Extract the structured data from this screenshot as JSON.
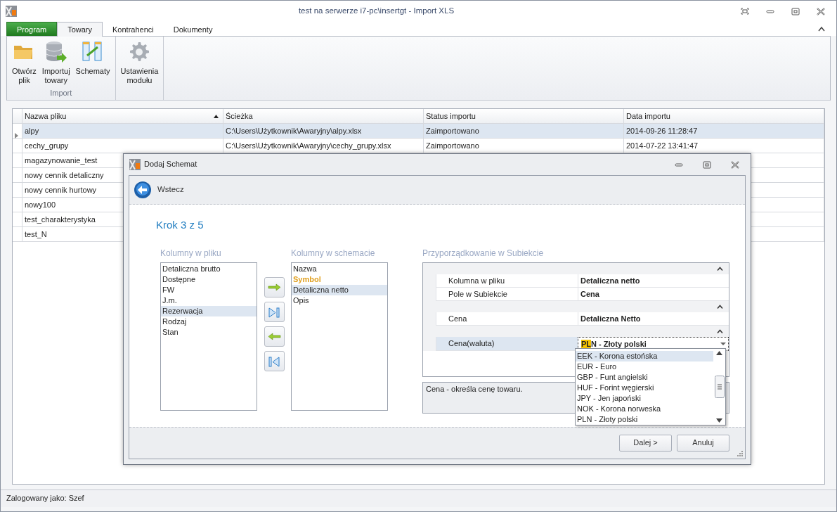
{
  "window": {
    "title": "test na serwerze i7-pc\\insertgt - Import XLS"
  },
  "ribbon_tabs": [
    {
      "label": "Program",
      "kind": "app",
      "selected": false
    },
    {
      "label": "Towary",
      "kind": "tab",
      "selected": true
    },
    {
      "label": "Kontrahenci",
      "kind": "tab",
      "selected": false
    },
    {
      "label": "Dokumenty",
      "kind": "tab",
      "selected": false
    }
  ],
  "ribbon_groups": [
    {
      "label": "Import",
      "buttons": [
        {
          "lines": [
            "Otwórz",
            "plik"
          ]
        },
        {
          "lines": [
            "Importuj",
            "towary"
          ]
        },
        {
          "lines": [
            "Schematy"
          ]
        }
      ]
    },
    {
      "buttons": [
        {
          "lines": [
            "Ustawienia",
            "modułu"
          ]
        }
      ]
    }
  ],
  "files_table": {
    "columns": [
      {
        "label": "Nazwa pliku",
        "sorted": true
      },
      {
        "label": "Ścieżka",
        "sorted": false
      },
      {
        "label": "Status importu",
        "sorted": false
      },
      {
        "label": "Data importu",
        "sorted": false
      }
    ],
    "rows": [
      {
        "selected": true,
        "cells": [
          "alpy",
          "C:\\Users\\Użytkownik\\Awaryjny\\alpy.xlsx",
          "Zaimportowano",
          "2014-09-26 11:28:47"
        ]
      },
      {
        "selected": false,
        "cells": [
          "cechy_grupy",
          "C:\\Users\\Użytkownik\\Awaryjny\\cechy_grupy.xlsx",
          "Zaimportowano",
          "2014-07-22 13:41:47"
        ]
      },
      {
        "selected": false,
        "cells": [
          "magazynowanie_test"
        ]
      },
      {
        "selected": false,
        "cells": [
          "nowy cennik detaliczny"
        ]
      },
      {
        "selected": false,
        "cells": [
          "nowy cennik hurtowy"
        ]
      },
      {
        "selected": false,
        "cells": [
          "nowy100"
        ]
      },
      {
        "selected": false,
        "cells": [
          "test_charakterystyka"
        ]
      },
      {
        "selected": false,
        "cells": [
          "test_N"
        ]
      }
    ]
  },
  "dialog": {
    "title": "Dodaj Schemat",
    "back_label": "Wstecz",
    "step": "Krok 3 z 5",
    "file_columns": {
      "label": "Kolumny w pliku",
      "items": [
        {
          "text": "Detaliczna brutto",
          "selected": false
        },
        {
          "text": "Dostępne",
          "selected": false
        },
        {
          "text": "FW",
          "selected": false
        },
        {
          "text": "J.m.",
          "selected": false
        },
        {
          "text": "Rezerwacja",
          "selected": true
        },
        {
          "text": "Rodzaj",
          "selected": false
        },
        {
          "text": "Stan",
          "selected": false
        }
      ]
    },
    "move_buttons": [
      {
        "kind": "add"
      },
      {
        "kind": "add_all"
      },
      {
        "kind": "remove"
      },
      {
        "kind": "remove_all"
      }
    ],
    "schema_columns": {
      "label": "Kolumny w schemacie",
      "items": [
        {
          "text": "Nazwa",
          "selected": false,
          "required": false
        },
        {
          "text": "Symbol",
          "selected": false,
          "required": true
        },
        {
          "text": "Detaliczna netto",
          "selected": true,
          "required": false
        },
        {
          "text": "Opis",
          "selected": false,
          "required": false
        }
      ]
    },
    "mapping": {
      "label": "Przyporządkowanie w Subiekcie",
      "sections": [
        {
          "expanded": true,
          "rows": [
            {
              "kind": "text",
              "label": "Kolumna w pliku",
              "value": "Detaliczna netto",
              "selected": false
            },
            {
              "kind": "text",
              "label": "Pole w Subiekcie",
              "value": "Cena",
              "selected": false
            }
          ]
        },
        {
          "expanded": true,
          "rows": [
            {
              "kind": "text",
              "label": "Cena",
              "value": "Detaliczna Netto",
              "selected": false
            }
          ]
        },
        {
          "expanded": true,
          "rows": [
            {
              "kind": "dropdown",
              "label": "Cena(waluta)",
              "typed": "PL",
              "rest": "N - Złoty polski",
              "selected": true,
              "options": [
                {
                  "text": "EEK - Korona estońska",
                  "selected": true
                },
                {
                  "text": "EUR - Euro",
                  "selected": false
                },
                {
                  "text": "GBP - Funt angielski",
                  "selected": false
                },
                {
                  "text": "HUF - Forint węgierski",
                  "selected": false
                },
                {
                  "text": "JPY - Jen japoński",
                  "selected": false
                },
                {
                  "text": "NOK - Korona norweska",
                  "selected": false
                },
                {
                  "text": "PLN - Złoty polski",
                  "selected": false
                }
              ]
            }
          ]
        }
      ],
      "description": "Cena - określa cenę towaru."
    },
    "buttons": [
      {
        "label": "Dalej >"
      },
      {
        "label": "Anuluj"
      }
    ]
  },
  "status_bar": {
    "text": "Zalogowany jako: Szef"
  }
}
